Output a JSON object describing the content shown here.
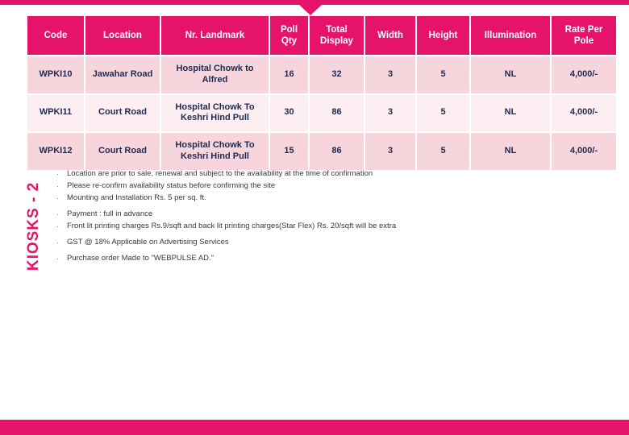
{
  "theme": {
    "accent": "#e5136a",
    "header_text": "#ffffff",
    "row_dark": "#f6d5dc",
    "row_light": "#fdeef1",
    "cell_text": "#1f2a52",
    "note_text": "#3a3a3a"
  },
  "side_label": "KIOSKS - 2",
  "table": {
    "columns": [
      "Code",
      "Location",
      "Nr. Landmark",
      "Poll Qty",
      "Total Display",
      "Width",
      "Height",
      "Illumination",
      "Rate Per Pole"
    ],
    "columns_multiline": [
      [
        "Code"
      ],
      [
        "Location"
      ],
      [
        "Nr. Landmark"
      ],
      [
        "Poll",
        "Qty"
      ],
      [
        "Total",
        "Display"
      ],
      [
        "Width"
      ],
      [
        "Height"
      ],
      [
        "Illumination"
      ],
      [
        "Rate Per",
        "Pole"
      ]
    ],
    "rows": [
      {
        "code": "WPKI10",
        "location": "Jawahar Road",
        "landmark": "Hospital Chowk to Alfred",
        "poll_qty": "16",
        "total_display": "32",
        "width": "3",
        "height": "5",
        "illumination": "NL",
        "rate_per_pole": "4,000/-"
      },
      {
        "code": "WPKI11",
        "location": "Court Road",
        "landmark": "Hospital Chowk To Keshri Hind Pull",
        "poll_qty": "30",
        "total_display": "86",
        "width": "3",
        "height": "5",
        "illumination": "NL",
        "rate_per_pole": "4,000/-"
      },
      {
        "code": "WPKI12",
        "location": "Court Road",
        "landmark": "Hospital Chowk To Keshri Hind Pull",
        "poll_qty": "15",
        "total_display": "86",
        "width": "3",
        "height": "5",
        "illumination": "NL",
        "rate_per_pole": "4,000/-"
      }
    ]
  },
  "notes": {
    "bullet": "·",
    "items": [
      "Location are prior to sale, renewal and subject to the availability at the time of confirmation",
      "Please re-confirm availability status before confirming the site",
      "Mounting and Installation Rs. 5 per sq. ft.",
      "Payment  : full  in advance",
      "Front lit printing charges Rs.9/sqft and back lit printing charges(Star Flex) Rs. 20/sqft will be extra",
      "GST @ 18% Applicable on Advertising Services",
      "Purchase order Made to \"WEBPULSE AD.\""
    ]
  }
}
